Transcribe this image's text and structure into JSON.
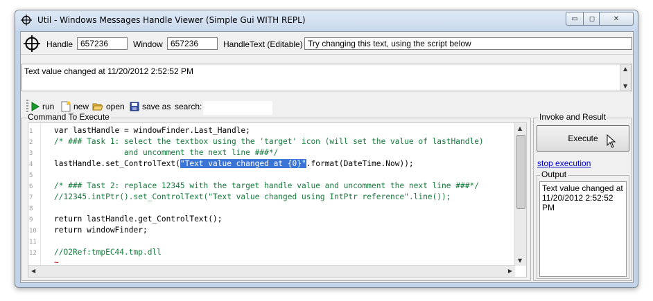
{
  "window": {
    "title": "Util - Windows Messages Handle Viewer (Simple Gui WITH REPL)",
    "controls": {
      "minimize": "▭",
      "maximize": "◻",
      "close": "✕"
    }
  },
  "top": {
    "handle_label": "Handle",
    "handle_value": "657236",
    "window_label": "Window",
    "window_value": "657236",
    "handletext_label": "HandleText (Editable)",
    "handletext_value": "Try changing this text, using the script below"
  },
  "status": {
    "text": "Text value changed at 11/20/2012 2:52:52 PM"
  },
  "toolbar": {
    "run": "run",
    "new": "new",
    "open": "open",
    "save_as": "save as",
    "search": "search:",
    "search_value": ""
  },
  "command": {
    "title": "Command To Execute",
    "line_numbers": [
      "1",
      "2",
      "3",
      "4",
      "5",
      "6",
      "7",
      "8",
      "9",
      "10",
      "11",
      "12"
    ],
    "lines": {
      "l1": "var lastHandle = windowFinder.Last_Handle;",
      "l2": "/* ### Task 1: select the textbox using the 'target' icon (will set the value of lastHandle)",
      "l3": "               and uncomment the next line ###*/",
      "l4a": "lastHandle.set_ControlText(",
      "l4b": "\"Text value changed at ",
      "l4c": "{0}",
      "l4d": "\"",
      "l4e": ".format(DateTime.Now));",
      "l6": "/* ### Tast 2: replace 12345 with the target handle value and uncomment the next line ###*/",
      "l7": "//12345.intPtr().set_ControlText(\"Text value changed using IntPtr reference\".line());",
      "l9": "return lastHandle.get_ControlText();",
      "l10": "return windowFinder;",
      "l12": "//O2Ref:tmpEC44.tmp.dll",
      "tilde": "~"
    }
  },
  "invoke": {
    "title": "Invoke and Result",
    "execute": "Execute",
    "stop": "stop execution",
    "output_title": "Output",
    "output_text": "Text value changed at 11/20/2012 2:52:52 PM"
  },
  "colors": {
    "comment": "#157a3b",
    "string": "#1f3fbf",
    "selection": "#3a74d4",
    "link": "#0000cc"
  },
  "icons": [
    "target-icon",
    "run-icon",
    "new-file-icon",
    "open-folder-icon",
    "save-icon",
    "cursor-icon"
  ]
}
